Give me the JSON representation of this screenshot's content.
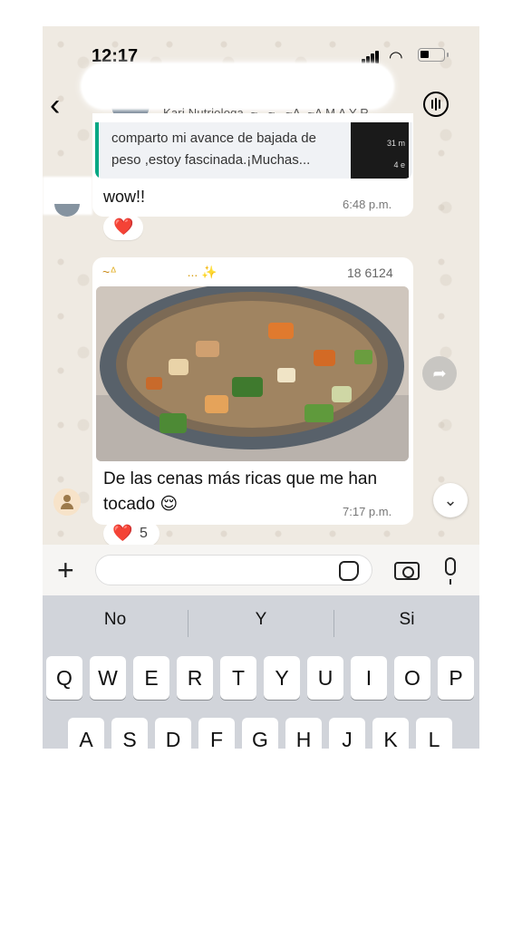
{
  "status": {
    "time": "12:17"
  },
  "header": {
    "members": "Kari Nutriologa, ~., ~., ~A, ~A M A Y R..."
  },
  "quoted": {
    "text": "comparto mi avance de bajada de peso ,estoy fascinada.¡Muchas...",
    "thumb_time": "31 m",
    "thumb_size": "4 e"
  },
  "message1": {
    "text": "wow!!",
    "time": "6:48 p.m.",
    "reaction": "❤️"
  },
  "message2": {
    "sender_prefix": "~",
    "sender_suffix": "... ✨",
    "phone": "18 6124",
    "caption": "De las cenas más ricas que me han tocado 😌",
    "time": "7:17 p.m.",
    "reaction": "❤️",
    "reaction_count": "5"
  },
  "suggestions": [
    "No",
    "Y",
    "Si"
  ],
  "keys_row1": [
    "Q",
    "W",
    "E",
    "R",
    "T",
    "Y",
    "U",
    "I",
    "O",
    "P"
  ],
  "keys_row2": [
    "A",
    "S",
    "D",
    "F",
    "G",
    "H",
    "J",
    "K",
    "L"
  ],
  "colors": {
    "accent": "#06a884",
    "chat_bg": "#efeae2",
    "sender": "#c98a1a"
  },
  "icons": [
    "back-arrow-icon",
    "voice-chat-icon",
    "forward-icon",
    "chevron-down-icon",
    "plus-icon",
    "sticker-icon",
    "camera-icon",
    "mic-icon",
    "person-icon"
  ]
}
